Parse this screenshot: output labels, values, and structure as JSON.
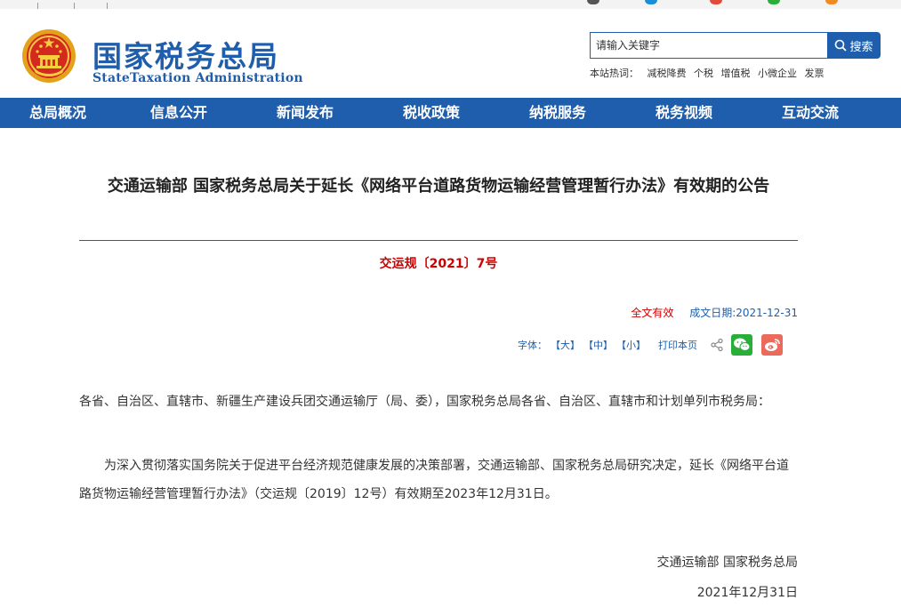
{
  "header": {
    "logo_cn": "国家税务总局",
    "logo_en": "StateTaxation Administration",
    "search": {
      "placeholder": "请输入关键字",
      "button_label": "搜索"
    },
    "hotwords_label": "本站热词：",
    "hotwords": [
      "减税降费",
      "个税",
      "增值税",
      "小微企业",
      "发票"
    ]
  },
  "nav": {
    "items": [
      "总局概况",
      "信息公开",
      "新闻发布",
      "税收政策",
      "纳税服务",
      "税务视频",
      "互动交流"
    ]
  },
  "article": {
    "title": "交通运输部 国家税务总局关于延长《网络平台道路货物运输经营管理暂行办法》有效期的公告",
    "doc_number": "交运规〔2021〕7号",
    "validity": "全文有效",
    "issue_date": "成文日期:2021-12-31",
    "tools": {
      "font_label": "字体：",
      "large": "【大】",
      "medium": "【中】",
      "small": "【小】",
      "print": "打印本页"
    },
    "paragraphs": [
      "各省、自治区、直辖市、新疆生产建设兵团交通运输厅（局、委），国家税务总局各省、自治区、直辖市和计划单列市税务局：",
      "为深入贯彻落实国务院关于促进平台经济规范健康发展的决策部署，交通运输部、国家税务总局研究决定，延长《网络平台道路货物运输经营管理暂行办法》（交运规〔2019〕12号）有效期至2023年12月31日。"
    ],
    "signature": "交通运输部  国家税务总局",
    "signature_date": "2021年12月31日"
  },
  "colors": {
    "brand_blue": "#1f5eac",
    "accent_red": "#cc0000",
    "wechat_green": "#2aae3a",
    "weibo_red": "#ec6a5c"
  },
  "icons": [
    "national-emblem-icon",
    "search-icon",
    "share-icon",
    "wechat-icon",
    "weibo-icon"
  ]
}
